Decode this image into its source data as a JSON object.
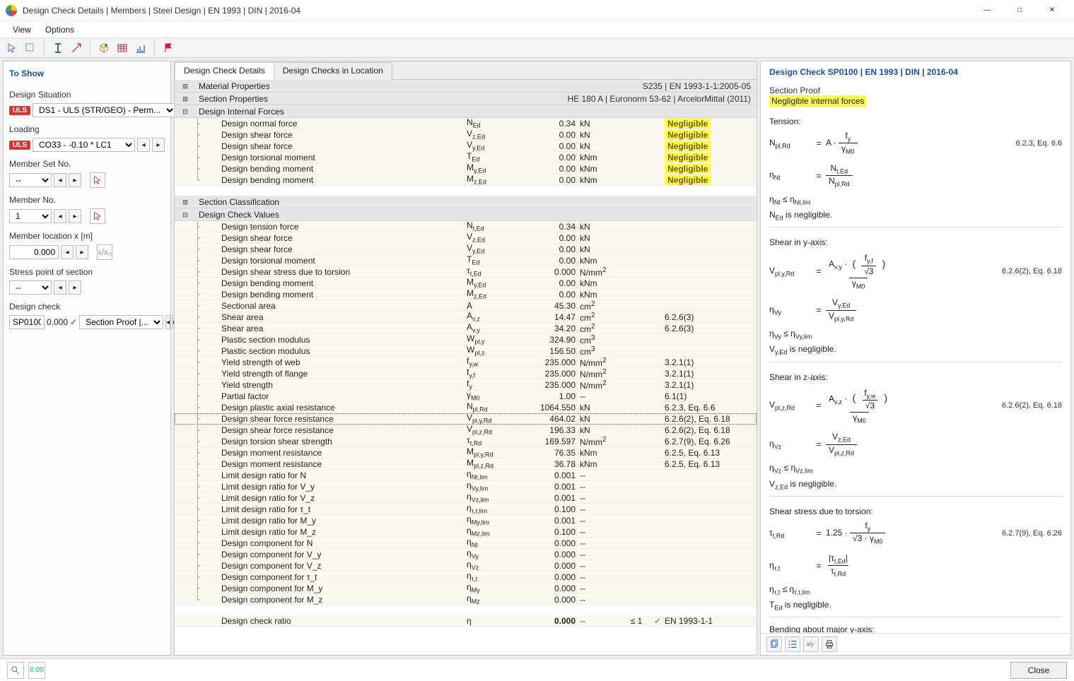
{
  "window": {
    "title": "Design Check Details | Members | Steel Design | EN 1993 | DIN | 2016-04"
  },
  "menu": {
    "view": "View",
    "options": "Options"
  },
  "left": {
    "header": "To Show",
    "situation_label": "Design Situation",
    "situation_value": "DS1 - ULS (STR/GEO) - Perm...",
    "loading_label": "Loading",
    "loading_value": "CO33 - -0.10 * LC1",
    "memberset_label": "Member Set No.",
    "memberset_value": "--",
    "member_label": "Member No.",
    "member_value": "1",
    "loc_label": "Member location x [m]",
    "loc_value": "0.000",
    "xx0": "x/x₀",
    "stress_label": "Stress point of section",
    "stress_value": "--",
    "check_label": "Design check",
    "check_code": "SP0100",
    "check_ratio": "0.000",
    "check_kind": "Section Proof |..."
  },
  "tabs": {
    "t1": "Design Check Details",
    "t2": "Design Checks in Location"
  },
  "sections": {
    "mat": {
      "title": "Material Properties",
      "meta": "S235 | EN 1993-1-1:2005-05"
    },
    "sec": {
      "title": "Section Properties",
      "meta": "HE 180 A | Euronorm 53-62 | ArcelorMittal (2011)"
    },
    "dif": {
      "title": "Design Internal Forces"
    },
    "scl": {
      "title": "Section Classification"
    },
    "dcv": {
      "title": "Design Check Values"
    }
  },
  "dif_rows": [
    {
      "name": "Design normal force",
      "sym": "N_Ed",
      "val": "0.34",
      "unit": "kN",
      "ref": "Negligible"
    },
    {
      "name": "Design shear force",
      "sym": "V_z,Ed",
      "val": "0.00",
      "unit": "kN",
      "ref": "Negligible"
    },
    {
      "name": "Design shear force",
      "sym": "V_y,Ed",
      "val": "0.00",
      "unit": "kN",
      "ref": "Negligible"
    },
    {
      "name": "Design torsional moment",
      "sym": "T_Ed",
      "val": "0.00",
      "unit": "kNm",
      "ref": "Negligible"
    },
    {
      "name": "Design bending moment",
      "sym": "M_y,Ed",
      "val": "0.00",
      "unit": "kNm",
      "ref": "Negligible"
    },
    {
      "name": "Design bending moment",
      "sym": "M_z,Ed",
      "val": "0.00",
      "unit": "kNm",
      "ref": "Negligible"
    }
  ],
  "dcv_rows": [
    {
      "name": "Design tension force",
      "sym": "N_t,Ed",
      "val": "0.34",
      "unit": "kN",
      "ref": ""
    },
    {
      "name": "Design shear force",
      "sym": "V_z,Ed",
      "val": "0.00",
      "unit": "kN",
      "ref": ""
    },
    {
      "name": "Design shear force",
      "sym": "V_y,Ed",
      "val": "0.00",
      "unit": "kN",
      "ref": ""
    },
    {
      "name": "Design torsional moment",
      "sym": "T_Ed",
      "val": "0.00",
      "unit": "kNm",
      "ref": ""
    },
    {
      "name": "Design shear stress due to torsion",
      "sym": "τ_t,Ed",
      "val": "0.000",
      "unit": "N/mm²",
      "ref": ""
    },
    {
      "name": "Design bending moment",
      "sym": "M_y,Ed",
      "val": "0.00",
      "unit": "kNm",
      "ref": ""
    },
    {
      "name": "Design bending moment",
      "sym": "M_z,Ed",
      "val": "0.00",
      "unit": "kNm",
      "ref": ""
    },
    {
      "name": "Sectional area",
      "sym": "A",
      "val": "45.30",
      "unit": "cm²",
      "ref": ""
    },
    {
      "name": "Shear area",
      "sym": "A_v,z",
      "val": "14.47",
      "unit": "cm²",
      "ref": "6.2.6(3)"
    },
    {
      "name": "Shear area",
      "sym": "A_v,y",
      "val": "34.20",
      "unit": "cm²",
      "ref": "6.2.6(3)"
    },
    {
      "name": "Plastic section modulus",
      "sym": "W_pl,y",
      "val": "324.90",
      "unit": "cm³",
      "ref": ""
    },
    {
      "name": "Plastic section modulus",
      "sym": "W_pl,z",
      "val": "156.50",
      "unit": "cm³",
      "ref": ""
    },
    {
      "name": "Yield strength of web",
      "sym": "f_y,w",
      "val": "235.000",
      "unit": "N/mm²",
      "ref": "3.2.1(1)"
    },
    {
      "name": "Yield strength of flange",
      "sym": "f_y,f",
      "val": "235.000",
      "unit": "N/mm²",
      "ref": "3.2.1(1)"
    },
    {
      "name": "Yield strength",
      "sym": "f_y",
      "val": "235.000",
      "unit": "N/mm²",
      "ref": "3.2.1(1)"
    },
    {
      "name": "Partial factor",
      "sym": "γ_M0",
      "val": "1.00",
      "unit": "--",
      "ref": "6.1(1)"
    },
    {
      "name": "Design plastic axial resistance",
      "sym": "N_pl,Rd",
      "val": "1064.550",
      "unit": "kN",
      "ref": "6.2.3, Eq. 6.6"
    },
    {
      "name": "Design shear force resistance",
      "sym": "V_pl,y,Rd",
      "val": "464.02",
      "unit": "kN",
      "ref": "6.2.6(2), Eq. 6.18",
      "sel": true
    },
    {
      "name": "Design shear force resistance",
      "sym": "V_pl,z,Rd",
      "val": "196.33",
      "unit": "kN",
      "ref": "6.2.6(2), Eq. 6.18"
    },
    {
      "name": "Design torsion shear strength",
      "sym": "τ_t,Rd",
      "val": "169.597",
      "unit": "N/mm²",
      "ref": "6.2.7(9), Eq. 6.26"
    },
    {
      "name": "Design moment resistance",
      "sym": "M_pl,y,Rd",
      "val": "76.35",
      "unit": "kNm",
      "ref": "6.2.5, Eq. 6.13"
    },
    {
      "name": "Design moment resistance",
      "sym": "M_pl,z,Rd",
      "val": "36.78",
      "unit": "kNm",
      "ref": "6.2.5, Eq. 6.13"
    },
    {
      "name": "Limit design ratio for N",
      "sym": "η_Nt,lim",
      "val": "0.001",
      "unit": "--",
      "ref": ""
    },
    {
      "name": "Limit design ratio for V_y",
      "sym": "η_Vy,lim",
      "val": "0.001",
      "unit": "--",
      "ref": ""
    },
    {
      "name": "Limit design ratio for V_z",
      "sym": "η_Vz,lim",
      "val": "0.001",
      "unit": "--",
      "ref": ""
    },
    {
      "name": "Limit design ratio for τ_t",
      "sym": "η_τ,t,lim",
      "val": "0.100",
      "unit": "--",
      "ref": ""
    },
    {
      "name": "Limit design ratio for M_y",
      "sym": "η_My,lim",
      "val": "0.001",
      "unit": "--",
      "ref": ""
    },
    {
      "name": "Limit design ratio for M_z",
      "sym": "η_Mz,lim",
      "val": "0.100",
      "unit": "--",
      "ref": ""
    },
    {
      "name": "Design component for N",
      "sym": "η_Nt",
      "val": "0.000",
      "unit": "--",
      "ref": ""
    },
    {
      "name": "Design component for V_y",
      "sym": "η_Vy",
      "val": "0.000",
      "unit": "--",
      "ref": ""
    },
    {
      "name": "Design component for V_z",
      "sym": "η_Vz",
      "val": "0.000",
      "unit": "--",
      "ref": ""
    },
    {
      "name": "Design component for τ_t",
      "sym": "η_τ,t",
      "val": "0.000",
      "unit": "--",
      "ref": ""
    },
    {
      "name": "Design component for M_y",
      "sym": "η_My",
      "val": "0.000",
      "unit": "--",
      "ref": ""
    },
    {
      "name": "Design component for M_z",
      "sym": "η_Mz",
      "val": "0.000",
      "unit": "--",
      "ref": ""
    }
  ],
  "final_row": {
    "name": "Design check ratio",
    "sym": "η",
    "val": "0.000",
    "unit": "--",
    "lim": "≤ 1",
    "ok": "✓",
    "ref": "EN 1993-1-1"
  },
  "right": {
    "title": "Design Check SP0100 | EN 1993 | DIN | 2016-04",
    "proof": "Section Proof",
    "highlight": "Negligible internal forces",
    "eq": {
      "tension_title": "Tension:",
      "tension_ref": "6.2.3, Eq. 6.6",
      "tension_neg": "N_Ed is negligible.",
      "sheary_title": "Shear in y-axis:",
      "sheary_ref": "6.2.6(2), Eq. 6.18",
      "sheary_neg": "V_y,Ed is negligible.",
      "shearz_title": "Shear in z-axis:",
      "shearz_ref": "6.2.6(2), Eq. 6.18",
      "shearz_neg": "V_z,Ed is negligible.",
      "tors_title": "Shear stress due to torsion:",
      "tors_ref": "6.2.7(9), Eq. 6.26",
      "tors_neg": "T_Ed is negligible.",
      "bendy_title": "Bending about major y-axis:"
    }
  },
  "footer": {
    "close": "Close"
  }
}
